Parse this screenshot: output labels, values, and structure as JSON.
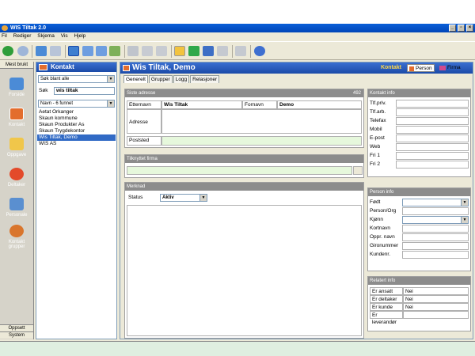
{
  "app": {
    "title": "WIS Tiltak 2.0"
  },
  "menu": [
    "Fil",
    "Rediger",
    "Skjema",
    "Vis",
    "Hjelp"
  ],
  "nav": {
    "header": "Mest brukt",
    "items": [
      {
        "label": "Forside",
        "icon": "home-icon"
      },
      {
        "label": "Kontakt",
        "icon": "contact-icon"
      },
      {
        "label": "Oppgave",
        "icon": "task-icon"
      },
      {
        "label": "Deltaker",
        "icon": "participant-icon"
      },
      {
        "label": "Personale",
        "icon": "staff-icon"
      },
      {
        "label": "Kontakt grupper",
        "icon": "group-icon"
      }
    ],
    "footer_oppsett": "Oppsett",
    "footer_system": "System"
  },
  "list_panel": {
    "title": "Kontakt",
    "search_scope": "Søk blant alle",
    "search_label": "Søk",
    "search_value": "wis tiltak",
    "sort_label": "Navn - 6 funnet",
    "items": [
      "Aetat Orkanger",
      "Skaun kommune",
      "Skaun Produkter As",
      "Skaun Trygdekontor",
      "Wis Tiltak, Demo",
      "WIS AS"
    ],
    "selected_index": 4
  },
  "main": {
    "title": "Wis Tiltak, Demo",
    "type_label": "Kontakt",
    "mode_person": "Person",
    "mode_firma": "Firma",
    "tabs": [
      "Generelt",
      "Grupper",
      "Logg",
      "Relasjoner"
    ],
    "address": {
      "header": "Siste adresse",
      "header_count": "492",
      "etternavn_label": "Etternavn",
      "etternavn_value": "Wis Tiltak",
      "fornavn_label": "Fornavn",
      "fornavn_value": "Demo",
      "adresse_label": "Adresse",
      "poststed_label": "Poststed"
    },
    "firma": {
      "header": "Tilknyttet firma"
    },
    "merknad": {
      "header": "Merknad",
      "status_label": "Status",
      "status_value": "Aktiv"
    },
    "kontaktinfo": {
      "header": "Kontakt info",
      "fields": [
        "Tlf.priv.",
        "Tlf.arb.",
        "Telefax",
        "Mobil",
        "E-post",
        "Web",
        "Fri 1",
        "Fri 2"
      ]
    },
    "personinfo": {
      "header": "Person info",
      "fields": [
        "Født",
        "Person/Org",
        "Kjønn",
        "Kortnavn",
        "Oppr. navn",
        "Gironummer",
        "Kundenr."
      ]
    },
    "relatert": {
      "header": "Relatert info",
      "rows": [
        {
          "label": "Er ansatt",
          "value": "Nei"
        },
        {
          "label": "Er deltaker",
          "value": "Nei"
        },
        {
          "label": "Er kunde",
          "value": "Nei"
        },
        {
          "label": "Er leverandør",
          "value": ""
        }
      ]
    }
  }
}
